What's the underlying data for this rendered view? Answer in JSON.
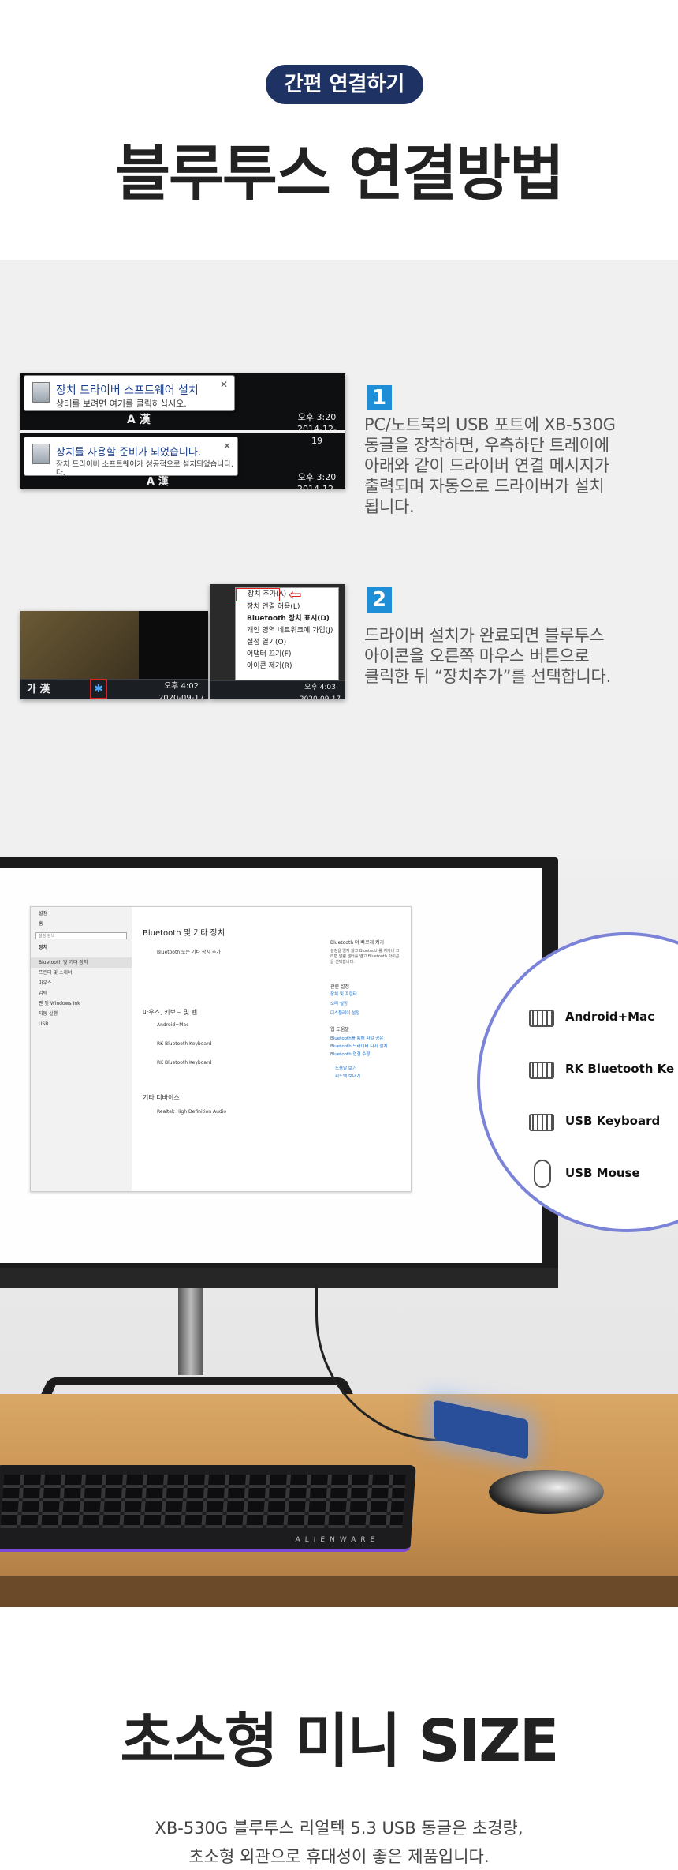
{
  "header": {
    "badge": "간편 연결하기",
    "title": "블루투스 연결방법"
  },
  "step1": {
    "number": "1",
    "text": "PC/노트북의 USB 포트에 XB-530G\n동글을 장착하면, 우측하단 트레이에\n아래와 같이 드라이버 연결 메시지가\n출력되며 자동으로 드라이버가 설치\n됩니다.",
    "bubble1_title": "장치 드라이버 소프트웨어 설치",
    "bubble1_sub": "상태를 보려면 여기를 클릭하십시오.",
    "bubble2_title": "장치를 사용할 준비가 되었습니다.",
    "bubble2_sub": "장치 드라이버 소프트웨어가 성공적으로 설치되었습니다.",
    "bubble2_sub2": "다.",
    "clock_time": "오후 3:20",
    "clock_date": "2014-12-19",
    "tray_ime": "A 漢"
  },
  "step2": {
    "number": "2",
    "text": "드라이버 설치가 완료되면 블루투스\n아이콘을 오른쪽 마우스 버튼으로\n클릭한 뒤 “장치추가”를 선택합니다.",
    "tray_ime": "가 漢",
    "clock_time": "오후 4:02",
    "clock_date": "2020-09-17",
    "clock_time2": "오후 4:03",
    "menu_items": [
      "장치 추가(A)",
      "장치 연결 허용(L)",
      "Bluetooth 장치 표시(D)",
      "개인 영역 네트워크에 가입(J)",
      "설정 열기(O)",
      "어댑터 끄기(F)",
      "아이콘 제거(R)"
    ]
  },
  "settings_window": {
    "header": "설정",
    "home": "홈",
    "search": "설정 검색",
    "category": "장치",
    "side_items": [
      "Bluetooth 및 기타 장치",
      "프린터 및 스캐너",
      "마우스",
      "입력",
      "펜 및 Windows Ink",
      "자동 실행",
      "USB"
    ],
    "main_title": "Bluetooth 및 기타 장치",
    "add_device": "Bluetooth 또는 기타 장치 추가",
    "mkp_heading": "마우스, 키보드 및 펜",
    "devices": [
      "Android+Mac",
      "RK Bluetooth Keyboard",
      "RK Bluetooth Keyboard"
    ],
    "other_heading": "기타 디바이스",
    "other_device": "Realtek High Definition Audio",
    "right_title": "Bluetooth 더 빠르게 켜기",
    "right_desc": "설정을 열지 않고 Bluetooth를 켜거나 끄려면 알림 센터를 열고 Bluetooth 아이콘을 선택합니다.",
    "related_heading": "관련 설정",
    "related_links": [
      "장치 및 프린터",
      "소리 설정",
      "디스플레이 설정"
    ],
    "help_heading": "웹 도움말",
    "help_links": [
      "Bluetooth를 통해 파일 공유",
      "Bluetooth 드라이버 다시 설치",
      "Bluetooth 연결 수정"
    ],
    "help_link": "도움말 보기",
    "feedback_link": "피드백 보내기"
  },
  "zoom_list": [
    {
      "icon": "keyboard-icon",
      "label": "Android+Mac"
    },
    {
      "icon": "keyboard-icon",
      "label": "RK Bluetooth Ke"
    },
    {
      "icon": "keyboard-icon",
      "label": "USB Keyboard"
    },
    {
      "icon": "mouse-icon",
      "label": "USB Mouse"
    }
  ],
  "keyboard_brand": "ALIENWARE",
  "footer": {
    "title": "초소형 미니 SIZE",
    "desc1": "XB-530G 블루투스 리얼텍 5.3 USB 동글은 초경량,",
    "desc2": "초소형 외관으로 휴대성이 좋은 제품입니다."
  },
  "colors": {
    "badge_bg": "#1f3264",
    "step_number_bg": "#1e8fd6",
    "zoom_border": "#7a83d8"
  }
}
